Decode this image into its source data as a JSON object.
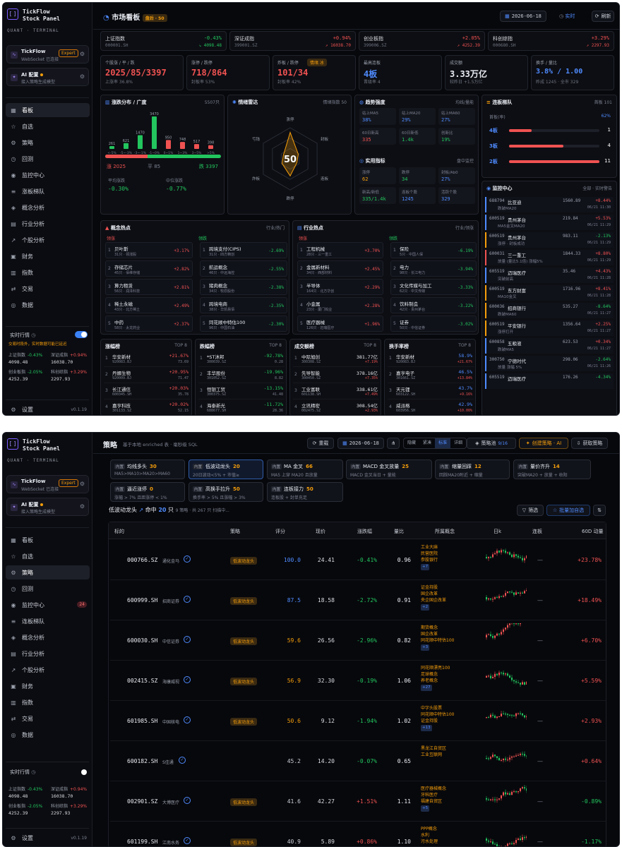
{
  "brand": {
    "title1": "TickFlow",
    "title2": "Stock Panel",
    "sub": "QUANT · TERMINAL",
    "glyph": "[ ]"
  },
  "cards": {
    "tickflow": {
      "title": "TickFlow",
      "sub": "WebSocket 已连接",
      "badge": "Expert"
    },
    "ai": {
      "title": "AI 配置",
      "sub": "接入策略生成模型"
    }
  },
  "nav": [
    {
      "icon": "▦",
      "label": "看板"
    },
    {
      "icon": "☆",
      "label": "自选"
    },
    {
      "icon": "⚙",
      "label": "策略"
    },
    {
      "icon": "◷",
      "label": "回测"
    },
    {
      "icon": "◉",
      "label": "监控中心"
    },
    {
      "icon": "≡",
      "label": "连板梯队"
    },
    {
      "icon": "◈",
      "label": "概念分析"
    },
    {
      "icon": "▤",
      "label": "行业分析"
    },
    {
      "icon": "↗",
      "label": "个股分析"
    },
    {
      "icon": "▣",
      "label": "财务"
    },
    {
      "icon": "▥",
      "label": "指数"
    },
    {
      "icon": "⇄",
      "label": "交易"
    },
    {
      "icon": "◎",
      "label": "数据"
    }
  ],
  "nav_s1_labels": [
    "看板",
    "自选",
    "策略",
    "回测",
    "监控中心",
    "涨板梯队",
    "概念分析",
    "行业分析",
    "个股分析",
    "财务",
    "指数",
    "交易",
    "数据"
  ],
  "monitor_count": "24",
  "realtime": {
    "title": "实时行情",
    "warn": "交易时段外，实时数据可能已延迟",
    "cells": [
      {
        "n": "上证指数",
        "p": "-0.43%",
        "v": "4098.48"
      },
      {
        "n": "深证成指",
        "p": "+0.94%",
        "v": "16038.70"
      },
      {
        "n": "创业板指",
        "p": "-2.05%",
        "v": "4252.39"
      },
      {
        "n": "科创综指",
        "p": "+3.29%",
        "v": "2297.93"
      }
    ]
  },
  "settings": {
    "label": "设置",
    "version": "v0.1.19"
  },
  "dash": {
    "title": "市场看板",
    "session": "盘后 · 50",
    "date": "2026-06-18",
    "live": "实时",
    "refresh": "刷新",
    "indices": [
      {
        "n": "上证指数",
        "c": "000001.SH",
        "p": "-0.43%",
        "v": "↘ 4098.48",
        "cls": "dn"
      },
      {
        "n": "深证成指",
        "c": "399001.SZ",
        "p": "+0.94%",
        "v": "↗ 16038.70",
        "cls": "up"
      },
      {
        "n": "创业板指",
        "c": "399006.SZ",
        "p": "+2.05%",
        "v": "↗ 4252.39",
        "cls": "up"
      },
      {
        "n": "科创综指",
        "c": "000680.SH",
        "p": "+3.29%",
        "v": "↗ 2297.93",
        "cls": "up"
      }
    ],
    "stats": [
      {
        "n": "个股涨 / 平 / 跌",
        "v": "2025/85/3397",
        "s": "上涨率 36.8%"
      },
      {
        "n": "涨停 / 跌停",
        "v": "718/864",
        "s": "封板率 53%"
      },
      {
        "n": "炸板 / 跌停",
        "v": "101/34",
        "s": "封板率 42%",
        "tag": "情绪 冰"
      },
      {
        "n": "最高连板",
        "v": "4板",
        "s": "晋级率 4"
      },
      {
        "n": "成交额",
        "v": "3.33万亿",
        "s": "较昨日 +1.5万亿"
      },
      {
        "n": "换手 / 量比",
        "v": "3.8% / 1.00",
        "s": "昨成 1245 · 全市 329"
      }
    ],
    "dist": {
      "title": "涨跌分布 / 广度",
      "right": "5507只",
      "bars": [
        {
          "l": "<-5%",
          "v": 261
        },
        {
          "l": "-5~-3%",
          "v": 621
        },
        {
          "l": "-3~-1%",
          "v": 1470
        },
        {
          "l": "-1~0%",
          "v": 3470
        },
        {
          "l": "0~1%",
          "v": 950
        },
        {
          "l": "1~3%",
          "v": 748
        },
        {
          "l": "3~5%",
          "v": 517
        },
        {
          "l": ">5%",
          "v": 398
        }
      ],
      "up": "涨 2025",
      "flat": "平 85",
      "down": "跌 3397",
      "avg_n": "平均涨跌",
      "avg_v": "-0.30%",
      "med_n": "中位涨跌",
      "med_v": "-0.77%"
    },
    "sent": {
      "title": "情绪雷达",
      "right": "情绪指数 50",
      "score": "50",
      "axes": [
        "涨停",
        "封板",
        "连板",
        "跌停",
        "炸板",
        "亏钱"
      ]
    },
    "breadth": {
      "title": "趋势强度",
      "right": "均线/量能",
      "cells": [
        {
          "n": "站上MA5",
          "v": "38%"
        },
        {
          "n": "站上MA20",
          "v": "29%"
        },
        {
          "n": "站上MA60",
          "v": "27%"
        },
        {
          "n": "60日新高",
          "v": "335"
        },
        {
          "n": "60日新低",
          "v": "1.4k"
        },
        {
          "n": "创新比",
          "v": "19%"
        }
      ]
    },
    "flow": {
      "title": "实用指标",
      "right": "盘中监控",
      "cells": [
        {
          "n": "涨停",
          "v": "62"
        },
        {
          "n": "跌停",
          "v": "34"
        },
        {
          "n": "封板/Ab0",
          "v": "27%"
        },
        {
          "n": "新高/新低",
          "v": "335/1.4k"
        },
        {
          "n": "连板个股",
          "v": "1245"
        },
        {
          "n": "活跃个股",
          "v": "329"
        }
      ]
    },
    "ladder": {
      "title": "连板梯队",
      "right": "首板 101",
      "first": "首板(率)",
      "first_v": "62%",
      "rows": [
        {
          "l": "4板",
          "v": "1"
        },
        {
          "l": "3板",
          "v": "4"
        },
        {
          "l": "2板",
          "v": "11"
        }
      ]
    },
    "monitor": {
      "title": "监控中心",
      "right": "全部 · 实时警告",
      "items": [
        {
          "c": "688794",
          "n": "比亚迪",
          "d": "跌破MA20",
          "p": "1560.89",
          "g": "+8.44%",
          "t": "06/21 11:30"
        },
        {
          "c": "600519",
          "n": "贵州茅台",
          "d": "MA5金叉MA20",
          "p": "219.84",
          "g": "+5.53%",
          "t": "06/21 11:29"
        },
        {
          "c": "600519",
          "n": "贵州茅台",
          "d": "涨停 · 封板成功",
          "p": "983.11",
          "g": "-2.13%",
          "t": "06/21 11:29"
        },
        {
          "c": "600031",
          "n": "三一重工",
          "d": "放量 (量比5.1倍) 涨幅5%",
          "p": "1844.33",
          "g": "+8.80%",
          "t": "06/21 11:29"
        },
        {
          "c": "605519",
          "n": "迈瑞医疗",
          "d": "突破前高",
          "p": "35.46",
          "g": "+4.43%",
          "t": "06/21 11:28"
        },
        {
          "c": "600519",
          "n": "东方财富",
          "d": "MA10金叉",
          "p": "1716.96",
          "g": "+8.41%",
          "t": "06/21 11:28"
        },
        {
          "c": "600036",
          "n": "招商银行",
          "d": "跌破MA60",
          "p": "535.27",
          "g": "-8.64%",
          "t": "06/21 11:27"
        },
        {
          "c": "600519",
          "n": "平安银行",
          "d": "涨停打开",
          "p": "1356.64",
          "g": "+2.25%",
          "t": "06/21 11:27"
        },
        {
          "c": "600858",
          "n": "五粮液",
          "d": "跌破MA5",
          "p": "623.53",
          "g": "+0.34%",
          "t": "06/21 11:27"
        },
        {
          "c": "300750",
          "n": "宁德时代",
          "d": "放量 涨幅 5%",
          "p": "298.06",
          "g": "-2.64%",
          "t": "06/21 11:26"
        },
        {
          "c": "605519",
          "n": "迈瑞医疗",
          "d": "",
          "p": "176.26",
          "g": "-4.34%",
          "t": ""
        }
      ]
    },
    "concept": {
      "title": "概念热点",
      "right": "行业/热门",
      "up_tag": "领涨",
      "dn_tag": "领跌",
      "up": [
        {
          "n": "贝叶斯",
          "s": "31只 · 领涨股",
          "p": "+3.17%"
        },
        {
          "n": "存储芯片",
          "s": "45只 · 佰维存储",
          "p": "+2.82%"
        },
        {
          "n": "算力租赁",
          "s": "56只 · 润泽科技",
          "p": "+2.81%"
        },
        {
          "n": "稀土永磁",
          "s": "43只 · 北方稀土",
          "p": "+2.49%"
        },
        {
          "n": "中药",
          "s": "58只 · 太龙药业",
          "p": "+2.37%"
        }
      ],
      "dn": [
        {
          "n": "跨境支付(CIPS)",
          "s": "31只 · 四方精创",
          "p": "-2.69%"
        },
        {
          "n": "航运概念",
          "s": "46只 · 中远海控",
          "p": "-2.55%"
        },
        {
          "n": "猪肉概念",
          "s": "34只 · 牧原股份",
          "p": "-2.38%"
        },
        {
          "n": "跨境电商",
          "s": "38只 · 华凯易佰",
          "p": "-2.35%"
        },
        {
          "n": "同花顺中特估100",
          "s": "96只 · 中国石油",
          "p": "-2.30%"
        }
      ]
    },
    "industry": {
      "title": "行业热点",
      "right": "行业/领涨",
      "up_tag": "领涨",
      "dn_tag": "领跌",
      "up": [
        {
          "n": "工程机械",
          "s": "28只 · 三一重工",
          "p": "+3.70%"
        },
        {
          "n": "金属新材料",
          "s": "34只 · 西部材料",
          "p": "+2.45%"
        },
        {
          "n": "半导体",
          "s": "164只 · 北方华创",
          "p": "+2.29%"
        },
        {
          "n": "小金属",
          "s": "23只 · 厦门钨业",
          "p": "+2.28%"
        },
        {
          "n": "医疗器械",
          "s": "126只 · 迈瑞医疗",
          "p": "+1.96%"
        }
      ],
      "dn": [
        {
          "n": "保险",
          "s": "5只 · 中国人保",
          "p": "-6.19%"
        },
        {
          "n": "电力",
          "s": "98只 · 长江电力",
          "p": "-3.94%"
        },
        {
          "n": "文化传媒与加工",
          "s": "62只 · 中文传媒",
          "p": "-3.33%"
        },
        {
          "n": "饮料制造",
          "s": "42只 · 贵州茅台",
          "p": "-3.22%"
        },
        {
          "n": "证券",
          "s": "50只 · 中信证券",
          "p": "-3.02%"
        }
      ]
    },
    "lists": [
      {
        "title": "涨幅榜",
        "right": "TOP 8",
        "rows": [
          {
            "n": "华安新材",
            "c": "920083.BJ",
            "v": "+21.67%",
            "s": "73.69"
          },
          {
            "n": "丹娜生物",
            "c": "920009.BJ",
            "v": "+20.95%",
            "s": "71.47"
          },
          {
            "n": "长江通信",
            "c": "600345.SH",
            "v": "+20.03%",
            "s": "35.78"
          },
          {
            "n": "嘉亨科技",
            "c": "301133.SZ",
            "v": "+20.02%",
            "s": "52.15"
          }
        ]
      },
      {
        "title": "跌幅榜",
        "right": "TOP 8",
        "rows": [
          {
            "n": "*ST沐邦",
            "c": "300039.SZ",
            "v": "-92.78%",
            "s": "0.28"
          },
          {
            "n": "丰华股份",
            "c": "301052.SZ",
            "v": "-19.96%",
            "s": "8.82"
          },
          {
            "n": "恒银工贸",
            "c": "300375.SZ",
            "v": "-13.15%",
            "s": "41.48"
          },
          {
            "n": "海泰新光",
            "c": "688677.SH",
            "v": "-11.72%",
            "s": "28.36"
          }
        ]
      },
      {
        "title": "成交额榜",
        "right": "TOP 8",
        "rows": [
          {
            "n": "中际旭创",
            "c": "300308.SZ",
            "v": "381.77亿",
            "s": "+7.19%"
          },
          {
            "n": "先导智能",
            "c": "300450.SZ",
            "v": "378.16亿",
            "s": "+7.35%"
          },
          {
            "n": "工业富联",
            "c": "601138.SH",
            "v": "338.61亿",
            "s": "+7.49%"
          },
          {
            "n": "立讯精密",
            "c": "002475.SZ",
            "v": "308.54亿",
            "s": "+2.93%"
          }
        ]
      },
      {
        "title": "换手率榜",
        "right": "TOP 8",
        "rows": [
          {
            "n": "华安新材",
            "c": "920083.BJ",
            "v": "58.9%",
            "s": "+21.67%"
          },
          {
            "n": "嘉亨电子",
            "c": "301661.SZ",
            "v": "46.5%",
            "s": "+13.84%"
          },
          {
            "n": "天元锂",
            "c": "603122.SH",
            "v": "43.7%",
            "s": "+9.16%"
          },
          {
            "n": "威派格",
            "c": "603956.SH",
            "v": "42.9%",
            "s": "+10.00%"
          }
        ]
      }
    ]
  },
  "strat": {
    "title": "策略",
    "sub": "基于本地 enriched 表 · 毫秒级 SQL",
    "reset": "重载",
    "date": "2026-06-18",
    "seg": [
      "隐藏",
      "紧凑",
      "标准",
      "详细"
    ],
    "pool": "策略池",
    "pool_count": "9/16",
    "create": "创建策略 · AI",
    "fetch": "获取策略",
    "tags": [
      {
        "k": "内置",
        "n": "均线多头",
        "c": "30",
        "d": "MA5>MA10>MA20>MA60"
      },
      {
        "k": "内置",
        "n": "低波动龙头",
        "c": "20",
        "d": "20日波动<5% + 市值≥"
      },
      {
        "k": "内置",
        "n": "MA 金叉",
        "c": "66",
        "d": "MA5 上穿 MA20 且放量"
      },
      {
        "k": "内置",
        "n": "MACD 金叉放量",
        "c": "25",
        "d": "MACD 金叉当日 + 量能"
      },
      {
        "k": "内置",
        "n": "缩量回踩",
        "c": "12",
        "d": "回踩MA20附近 + 缩量"
      },
      {
        "k": "内置",
        "n": "量价齐升",
        "c": "14",
        "d": "突破MA20 + 放量 + 收阳"
      },
      {
        "k": "内置",
        "n": "逼近涨停",
        "c": "0",
        "d": "涨幅 > 7% 且距涨停 < 1%"
      },
      {
        "k": "内置",
        "n": "高换手拉升",
        "c": "50",
        "d": "换手率 > 5% 且涨幅 > 3%"
      },
      {
        "k": "内置",
        "n": "连板接力",
        "c": "50",
        "d": "连板股 + 封单充足"
      }
    ],
    "sel_name": "低波动龙头",
    "hit": "命中",
    "hit_n": "20",
    "unit": "只",
    "scan": "9 策略 · 共 267 只 扫描中...",
    "filter": "筛选",
    "batch": "批量加自选",
    "headers": [
      "标的",
      "策略",
      "评分",
      "现价",
      "涨跌幅",
      "量比",
      "所属概念",
      "日k",
      "连板",
      "60D 动量"
    ],
    "rows": [
      {
        "c": "000766.SZ",
        "n": "通化金马",
        "s": "低波动龙头",
        "sc": "100.0",
        "px": "24.41",
        "ch": "-0.41%",
        "vr": "0.96",
        "cons": [
          "工业大麻",
          "民营医院",
          "参股银行"
        ],
        "plus": "+7",
        "lb": "—",
        "m": "+23.78%"
      },
      {
        "c": "600999.SH",
        "n": "招商证券",
        "s": "低波动龙头",
        "sc": "87.5",
        "px": "18.58",
        "ch": "-2.72%",
        "vr": "0.91",
        "cons": [
          "证金持股",
          "国企改革",
          "央企国企改革"
        ],
        "plus": "+2",
        "lb": "—",
        "m": "+18.49%"
      },
      {
        "c": "600030.SH",
        "n": "中信证券",
        "s": "低波动龙头",
        "sc": "59.6",
        "px": "26.56",
        "ch": "-2.96%",
        "vr": "0.82",
        "cons": [
          "期货概念",
          "国企改革",
          "同花顺中特估100"
        ],
        "plus": "+3",
        "lb": "—",
        "m": "+6.70%"
      },
      {
        "c": "002415.SZ",
        "n": "海康威视",
        "s": "低波动龙头",
        "sc": "56.9",
        "px": "32.30",
        "ch": "-0.19%",
        "vr": "1.06",
        "cons": [
          "同花顺漂亮100",
          "足球概念",
          "养老概念"
        ],
        "plus": "+27",
        "lb": "—",
        "m": "+5.59%"
      },
      {
        "c": "601985.SH",
        "n": "中国核电",
        "s": "低波动龙头",
        "sc": "50.6",
        "px": "9.12",
        "ch": "-1.94%",
        "vr": "1.02",
        "cons": [
          "中字头股票",
          "同花顺中特估100",
          "证金持股"
        ],
        "plus": "+13",
        "lb": "—",
        "m": "+2.93%"
      },
      {
        "c": "600182.SH",
        "n": "S佳通",
        "s": "",
        "sc": "45.2",
        "px": "14.20",
        "ch": "-0.07%",
        "vr": "0.65",
        "cons": [
          "黑龙江自贸区",
          "工业互联网"
        ],
        "plus": "",
        "lb": "—",
        "m": "+0.64%"
      },
      {
        "c": "002901.SZ",
        "n": "大博医疗",
        "s": "低波动龙头",
        "sc": "41.6",
        "px": "42.27",
        "ch": "+1.51%",
        "vr": "1.11",
        "cons": [
          "医疗器械概念",
          "牙科医疗",
          "福建自贸区"
        ],
        "plus": "+5",
        "lb": "—",
        "m": "-0.89%"
      },
      {
        "c": "601199.SH",
        "n": "江南水务",
        "s": "低波动龙头",
        "sc": "40.9",
        "px": "5.89",
        "ch": "+0.86%",
        "vr": "1.10",
        "cons": [
          "PPP概念",
          "水利",
          "污水处理"
        ],
        "plus": "",
        "lb": "—",
        "m": "-1.17%"
      }
    ]
  },
  "colors": {
    "up": "#f05252",
    "down": "#22c55e",
    "accent": "#4f8bff",
    "warn": "#f59e0b"
  }
}
